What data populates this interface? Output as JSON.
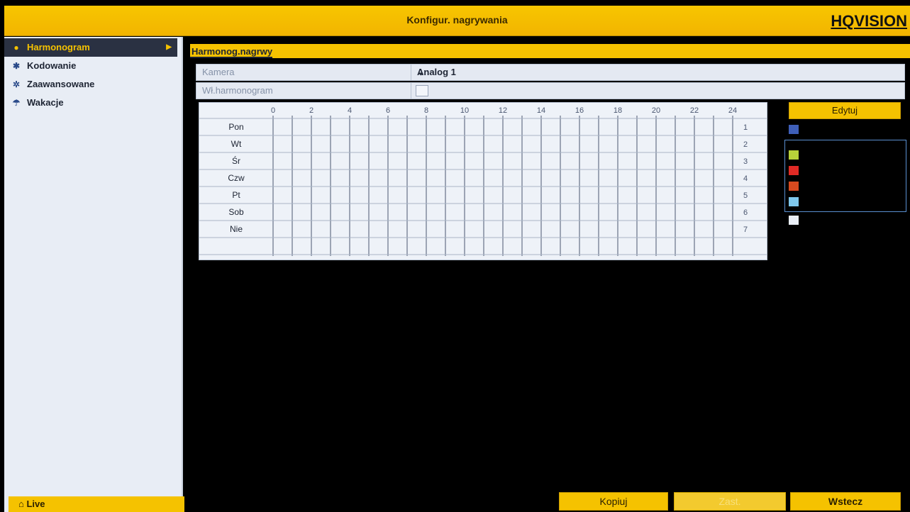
{
  "window": {
    "title": "Konfigur. nagrywania",
    "logo": "HQVISION"
  },
  "sidebar": {
    "items": [
      {
        "label": "Harmonogram",
        "icon": "record-icon",
        "active": true
      },
      {
        "label": "Kodowanie",
        "icon": "gear-icon",
        "active": false
      },
      {
        "label": "Zaawansowane",
        "icon": "advanced-icon",
        "active": false
      },
      {
        "label": "Wakacje",
        "icon": "umbrella-icon",
        "active": false
      }
    ],
    "live_label": "Live"
  },
  "main": {
    "section_title": "Harmonog.nagrwy",
    "camera": {
      "label": "Kamera",
      "value": "Analog 1"
    },
    "schedule_toggle": {
      "label": "Wł.harmonogram",
      "checked": false
    },
    "grid": {
      "hours": [
        "0",
        "2",
        "4",
        "6",
        "8",
        "10",
        "12",
        "14",
        "16",
        "18",
        "20",
        "22",
        "24"
      ],
      "days": [
        "Pon",
        "Wt",
        "Śr",
        "Czw",
        "Pt",
        "Sob",
        "Nie"
      ],
      "day_numbers": [
        "1",
        "2",
        "3",
        "4",
        "5",
        "6",
        "7"
      ]
    },
    "edit_label": "Edytuj",
    "legend_colors": [
      "#3f5fb8",
      "#b8d33a",
      "#e02a25",
      "#d84a1f",
      "#7fc8ec",
      "#e9eef6"
    ]
  },
  "footer": {
    "copy_label": "Kopiuj",
    "apply_label": "Zast.",
    "back_label": "Wstecz"
  },
  "colors": {
    "accent": "#f5c200",
    "panel": "#e8edf5",
    "background": "#000000"
  }
}
